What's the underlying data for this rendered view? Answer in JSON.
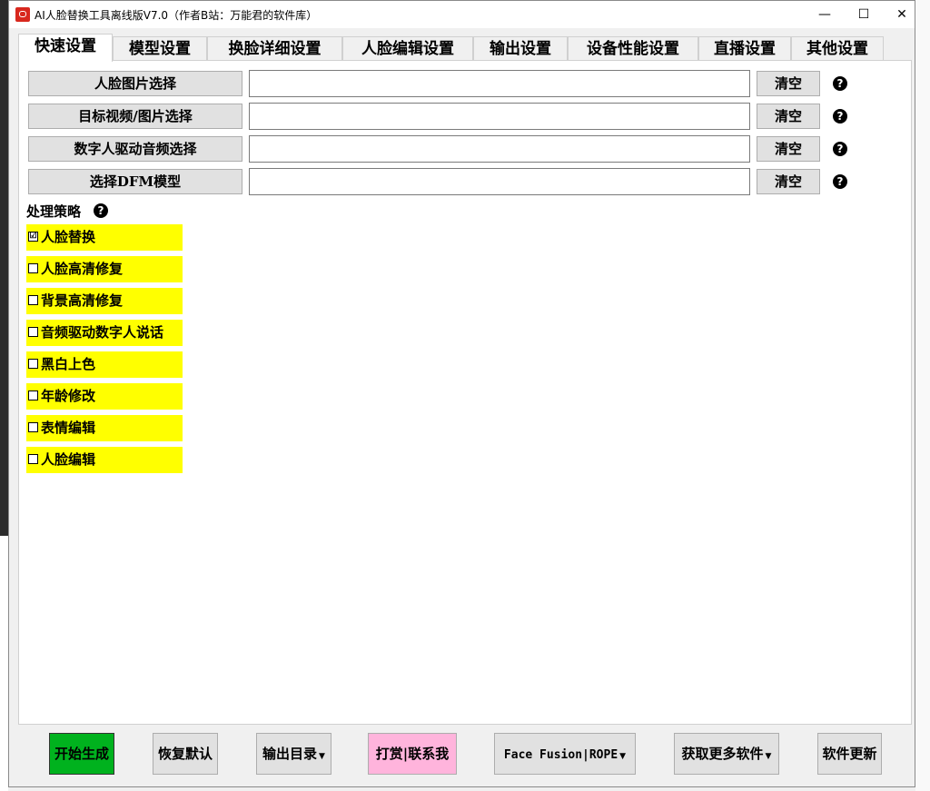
{
  "window": {
    "title": "AI人脸替换工具离线版V7.0（作者B站：万能君的软件库）",
    "minimize": "—",
    "maximize": "☐",
    "close": "✕"
  },
  "tabs": [
    {
      "label": "快速设置",
      "active": true
    },
    {
      "label": "模型设置"
    },
    {
      "label": "换脸详细设置"
    },
    {
      "label": "人脸编辑设置"
    },
    {
      "label": "输出设置"
    },
    {
      "label": "设备性能设置"
    },
    {
      "label": "直播设置"
    },
    {
      "label": "其他设置"
    }
  ],
  "file_rows": [
    {
      "button": "人脸图片选择",
      "value": "",
      "clear": "清空",
      "help": "?"
    },
    {
      "button": "目标视频/图片选择",
      "value": "",
      "clear": "清空",
      "help": "?"
    },
    {
      "button": "数字人驱动音频选择",
      "value": "",
      "clear": "清空",
      "help": "?"
    },
    {
      "button": "选择DFM模型",
      "value": "",
      "clear": "清空",
      "help": "?"
    }
  ],
  "strategy": {
    "label": "处理策略",
    "help": "?",
    "options": [
      {
        "label": "人脸替换",
        "checked": true,
        "mark": "☑"
      },
      {
        "label": "人脸高清修复",
        "checked": false,
        "mark": ""
      },
      {
        "label": "背景高清修复",
        "checked": false,
        "mark": ""
      },
      {
        "label": "音频驱动数字人说话",
        "checked": false,
        "mark": ""
      },
      {
        "label": "黑白上色",
        "checked": false,
        "mark": ""
      },
      {
        "label": "年龄修改",
        "checked": false,
        "mark": ""
      },
      {
        "label": "表情编辑",
        "checked": false,
        "mark": ""
      },
      {
        "label": "人脸编辑",
        "checked": false,
        "mark": ""
      }
    ]
  },
  "bottom_buttons": {
    "start": "开始生成",
    "restore": "恢复默认",
    "output_dir": "输出目录",
    "donate": "打赏|联系我",
    "engine": "Face Fusion|ROPE",
    "more_software": "获取更多软件",
    "update": "软件更新"
  },
  "colors": {
    "option_bg": "#ffff00",
    "start_bg": "#00b21e",
    "donate_bg": "#ffb4dc"
  }
}
